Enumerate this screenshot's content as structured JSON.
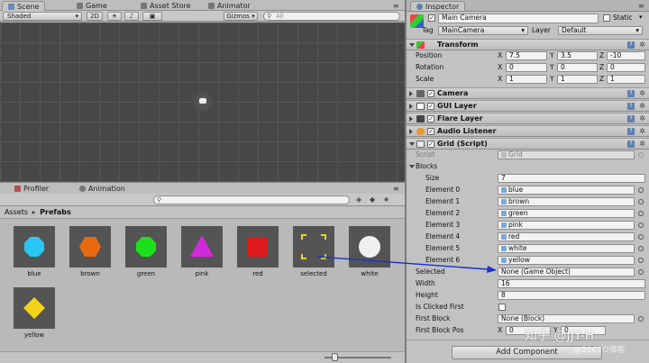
{
  "tabs": {
    "scene": "Scene",
    "game": "Game",
    "asset_store": "Asset Store",
    "animator": "Animator",
    "inspector": "Inspector",
    "profiler": "Profiler",
    "animation": "Animation"
  },
  "scene_toolbar": {
    "shading_mode": "Shaded",
    "mode_2d": "2D",
    "gizmos": "Gizmos",
    "search_placeholder": "All"
  },
  "project": {
    "breadcrumb_root": "Assets",
    "breadcrumb_separator": "▸",
    "breadcrumb_folder": "Prefabs",
    "assets": [
      {
        "name": "blue",
        "color": "#29c7f3"
      },
      {
        "name": "brown",
        "color": "#e86a0e"
      },
      {
        "name": "green",
        "color": "#1de01d"
      },
      {
        "name": "pink",
        "color": "#d12bd9"
      },
      {
        "name": "red",
        "color": "#e01a1a"
      },
      {
        "name": "selected",
        "color": "#e6d81e"
      },
      {
        "name": "white",
        "color": "#f0f0f0"
      },
      {
        "name": "yellow",
        "color": "#f2d41a"
      }
    ]
  },
  "inspector": {
    "object_name": "Main Camera",
    "static_label": "Static",
    "tag_label": "Tag",
    "tag_value": "MainCamera",
    "layer_label": "Layer",
    "layer_value": "Default",
    "transform": {
      "title": "Transform",
      "position_label": "Position",
      "rotation_label": "Rotation",
      "scale_label": "Scale",
      "axis_x": "X",
      "axis_y": "Y",
      "axis_z": "Z",
      "position": {
        "x": "7.5",
        "y": "3.5",
        "z": "-10"
      },
      "rotation": {
        "x": "0",
        "y": "0",
        "z": "0"
      },
      "scale": {
        "x": "1",
        "y": "1",
        "z": "1"
      }
    },
    "components": [
      "Camera",
      "GUI Layer",
      "Flare Layer",
      "Audio Listener"
    ],
    "grid": {
      "title": "Grid (Script)",
      "script_label": "Script",
      "script_value": "Grid",
      "blocks_label": "Blocks",
      "size_label": "Size",
      "size_value": "7",
      "elements": [
        {
          "label": "Element 0",
          "value": "blue"
        },
        {
          "label": "Element 1",
          "value": "brown"
        },
        {
          "label": "Element 2",
          "value": "green"
        },
        {
          "label": "Element 3",
          "value": "pink"
        },
        {
          "label": "Element 4",
          "value": "red"
        },
        {
          "label": "Element 5",
          "value": "white"
        },
        {
          "label": "Element 6",
          "value": "yellow"
        }
      ],
      "selected_label": "Selected",
      "selected_value": "None (Game Object)",
      "width_label": "Width",
      "width_value": "16",
      "height_label": "Height",
      "height_value": "8",
      "is_clicked_first_label": "Is Clicked First",
      "first_block_label": "First Block",
      "first_block_value": "None (Block)",
      "first_block_pos_label": "First Block Pos",
      "first_block_pos_x": "0",
      "first_block_pos_y": "0"
    },
    "add_component": "Add Component"
  },
  "watermark": "知乎 @JJY-H",
  "watermark2": "@51CTO博客",
  "colors": {
    "arrow": "#1a33c8",
    "scene_bg": "#4a4a4a",
    "accent_help": "#5d7fb2"
  }
}
